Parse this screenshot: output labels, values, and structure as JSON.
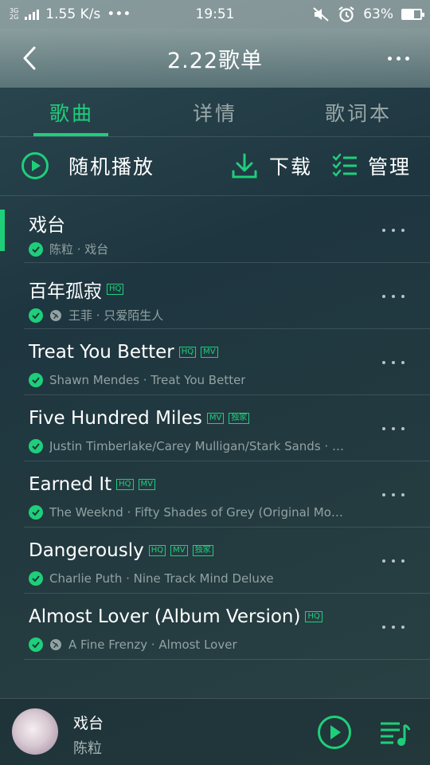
{
  "status": {
    "network_top": "3G",
    "network_bottom": "2G",
    "speed": "1.55 K/s",
    "time": "19:51",
    "battery": "63%",
    "battery_level": 0.63
  },
  "header": {
    "title": "2.22歌单"
  },
  "tabs": [
    {
      "label": "歌曲",
      "active": true
    },
    {
      "label": "详情",
      "active": false
    },
    {
      "label": "歌词本",
      "active": false
    }
  ],
  "actions": {
    "shuffle_label": "随机播放",
    "download_label": "下载",
    "manage_label": "管理"
  },
  "songs": [
    {
      "title": "戏台",
      "subtitle": "陈粒 · 戏台",
      "badges": [],
      "globe": false,
      "playing": true
    },
    {
      "title": "百年孤寂",
      "subtitle": "王菲 · 只爱陌生人",
      "badges": [
        "HQ"
      ],
      "globe": true,
      "playing": false
    },
    {
      "title": "Treat You Better",
      "subtitle": "Shawn Mendes · Treat You Better",
      "badges": [
        "HQ",
        "MV"
      ],
      "globe": false,
      "playing": false
    },
    {
      "title": "Five Hundred Miles",
      "subtitle": "Justin Timberlake/Carey Mulligan/Stark Sands · In…",
      "badges": [
        "MV",
        "独家"
      ],
      "globe": false,
      "playing": false
    },
    {
      "title": "Earned It",
      "subtitle": "The Weeknd · Fifty Shades of Grey (Original Moti…",
      "badges": [
        "HQ",
        "MV"
      ],
      "globe": false,
      "playing": false
    },
    {
      "title": "Dangerously",
      "subtitle": "Charlie Puth · Nine Track Mind Deluxe",
      "badges": [
        "HQ",
        "MV",
        "独家"
      ],
      "globe": false,
      "playing": false
    },
    {
      "title": "Almost Lover (Album Version)",
      "subtitle": "A Fine Frenzy · Almost Lover",
      "badges": [
        "HQ"
      ],
      "globe": true,
      "playing": false
    }
  ],
  "now_playing": {
    "title": "戏台",
    "artist": "陈粒"
  },
  "colors": {
    "accent": "#1ecf7a"
  }
}
